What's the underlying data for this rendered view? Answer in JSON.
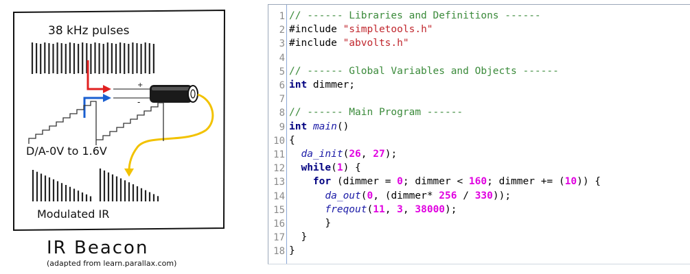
{
  "sketch": {
    "label_pulses": "38 kHz pulses",
    "label_da": "D/A-0V to 1.6V",
    "label_modulated": "Modulated IR",
    "title": "IR Beacon",
    "credit": "(adapted from learn.parallax.com)",
    "plus": "+",
    "minus": "-"
  },
  "editor": {
    "line_numbers": [
      "1",
      "2",
      "3",
      "4",
      "5",
      "6",
      "7",
      "8",
      "9",
      "10",
      "11",
      "12",
      "13",
      "14",
      "15",
      "16",
      "17",
      "18"
    ],
    "lines": [
      [
        {
          "t": "// ------ Libraries and Definitions ------",
          "c": "c"
        }
      ],
      [
        {
          "t": "#include ",
          "c": "pp"
        },
        {
          "t": "\"simpletools.h\"",
          "c": "s"
        }
      ],
      [
        {
          "t": "#include ",
          "c": "pp"
        },
        {
          "t": "\"abvolts.h\"",
          "c": "s"
        }
      ],
      [],
      [
        {
          "t": "// ------ Global Variables and Objects ------",
          "c": "c"
        }
      ],
      [
        {
          "t": "int",
          "c": "kw"
        },
        {
          "t": " dimmer;",
          "c": ""
        }
      ],
      [],
      [
        {
          "t": "// ------ Main Program ------",
          "c": "c"
        }
      ],
      [
        {
          "t": "int",
          "c": "kw"
        },
        {
          "t": " ",
          "c": ""
        },
        {
          "t": "main",
          "c": "fn"
        },
        {
          "t": "()",
          "c": ""
        }
      ],
      [
        {
          "t": "{",
          "c": ""
        }
      ],
      [
        {
          "t": "  ",
          "c": ""
        },
        {
          "t": "da_init",
          "c": "fn"
        },
        {
          "t": "(",
          "c": ""
        },
        {
          "t": "26",
          "c": "n"
        },
        {
          "t": ", ",
          "c": ""
        },
        {
          "t": "27",
          "c": "n"
        },
        {
          "t": ");",
          "c": ""
        }
      ],
      [
        {
          "t": "  ",
          "c": ""
        },
        {
          "t": "while",
          "c": "kw"
        },
        {
          "t": "(",
          "c": ""
        },
        {
          "t": "1",
          "c": "n"
        },
        {
          "t": ") {",
          "c": ""
        }
      ],
      [
        {
          "t": "    ",
          "c": ""
        },
        {
          "t": "for",
          "c": "kw"
        },
        {
          "t": " (dimmer = ",
          "c": ""
        },
        {
          "t": "0",
          "c": "n"
        },
        {
          "t": "; dimmer < ",
          "c": ""
        },
        {
          "t": "160",
          "c": "n"
        },
        {
          "t": "; dimmer += (",
          "c": ""
        },
        {
          "t": "10",
          "c": "n"
        },
        {
          "t": ")) {",
          "c": ""
        }
      ],
      [
        {
          "t": "      ",
          "c": ""
        },
        {
          "t": "da_out",
          "c": "fn"
        },
        {
          "t": "(",
          "c": ""
        },
        {
          "t": "0",
          "c": "n"
        },
        {
          "t": ", (dimmer* ",
          "c": ""
        },
        {
          "t": "256",
          "c": "n"
        },
        {
          "t": " / ",
          "c": ""
        },
        {
          "t": "330",
          "c": "n"
        },
        {
          "t": "));",
          "c": ""
        }
      ],
      [
        {
          "t": "      ",
          "c": ""
        },
        {
          "t": "freqout",
          "c": "fn"
        },
        {
          "t": "(",
          "c": ""
        },
        {
          "t": "11",
          "c": "n"
        },
        {
          "t": ", ",
          "c": ""
        },
        {
          "t": "3",
          "c": "n"
        },
        {
          "t": ", ",
          "c": ""
        },
        {
          "t": "38000",
          "c": "n"
        },
        {
          "t": ");",
          "c": ""
        }
      ],
      [
        {
          "t": "      }",
          "c": ""
        }
      ],
      [
        {
          "t": "  }",
          "c": ""
        }
      ],
      [
        {
          "t": "}",
          "c": ""
        }
      ]
    ]
  },
  "colors": {
    "comment": "#3a8a3a",
    "string": "#c0262d",
    "keyword": "#000080",
    "function": "#1a1aa6",
    "number": "#e000e0",
    "arrow_red": "#e02020",
    "arrow_blue": "#1a5fd0",
    "arrow_yellow": "#f2c200"
  }
}
